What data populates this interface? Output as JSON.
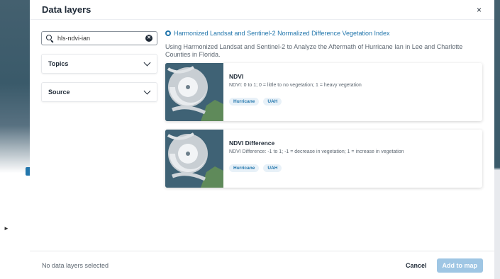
{
  "modal": {
    "title": "Data layers",
    "close_label": "×"
  },
  "filters": {
    "search": {
      "value": "hls-ndvi-ian",
      "placeholder": ""
    },
    "dropdowns": [
      {
        "label": "Topics"
      },
      {
        "label": "Source"
      }
    ]
  },
  "dataset": {
    "title": "Harmonized Landsat and Sentinel-2 Normalized Difference Vegetation Index",
    "description": "Using Harmonized Landsat and Sentinel-2 to Analyze the Aftermath of Hurricane Ian in Lee and Charlotte Counties in Florida.",
    "icon": "dataset-icon",
    "accent_color": "#2276ac"
  },
  "layers": [
    {
      "name": "NDVI",
      "description": "NDVI: 0 to 1; 0 = little to no vegetation; 1 = heavy vegetation",
      "tags": [
        "Hurricane",
        "UAH"
      ]
    },
    {
      "name": "NDVI Difference",
      "description": "NDVI Difference: -1 to 1; -1 = decrease in vegetation; 1 = increase in vegetation",
      "tags": [
        "Hurricane",
        "UAH"
      ]
    }
  ],
  "footer": {
    "status": "No data layers selected",
    "cancel_label": "Cancel",
    "add_label": "Add to map"
  }
}
